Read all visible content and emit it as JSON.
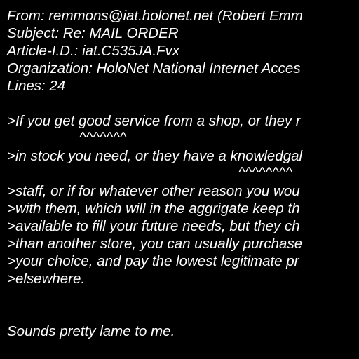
{
  "colors": {
    "background": "#000000",
    "text": "#ffffff"
  },
  "header": {
    "from": "From: remmons@iat.holonet.net (Robert Emm",
    "subject": "Subject: Re: MAIL ORDER",
    "article_id": "Article-I.D.: iat.C535JA.Fvx",
    "organization": "Organization: HoloNet National Internet Acces",
    "lines": "Lines: 24"
  },
  "quoted": {
    "line1": ">If you get good service from a shop, or they r",
    "mark1": "^^^^^^^",
    "line2": ">in stock you need, or they have a knowledgal",
    "mark2": "^^^^^^^^",
    "line3": ">staff, or if for whatever other reason you wou",
    "line4": ">with them, which will in the aggrigate keep th",
    "line5": ">available to fill your future needs, but they ch",
    "line6": ">than another store, you can usually purchase",
    "line7": ">your choice, and pay the lowest legitimate pr",
    "line8": ">elsewhere."
  },
  "reply": {
    "text": "Sounds pretty lame to me."
  }
}
